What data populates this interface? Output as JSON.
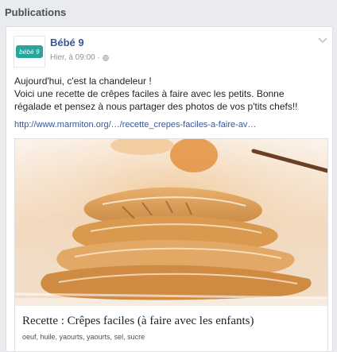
{
  "section": {
    "title": "Publications"
  },
  "post": {
    "author": "Bébé 9",
    "avatar_text": "bébé 9",
    "timestamp": "Hier, à 09:00 ·",
    "text_lines": [
      "Aujourd'hui, c'est la chandeleur !",
      "Voici une recette de crêpes faciles à faire avec les petits. Bonne",
      "régalade et pensez à nous partager des photos de vos p'tits chefs!!"
    ],
    "link": "http://www.marmiton.org/…/recette_crepes-faciles-a-faire-av…",
    "preview": {
      "title": "Recette : Crêpes faciles (à faire avec les enfants)",
      "description": "oeuf, huile, yaourts, yaourts, sel, sucre"
    }
  },
  "icons": {
    "globe": "globe-icon",
    "chevron": "chevron-down-icon"
  },
  "colors": {
    "link_blue": "#365899",
    "brand_teal": "#2aa39b",
    "meta_gray": "#90949c"
  }
}
